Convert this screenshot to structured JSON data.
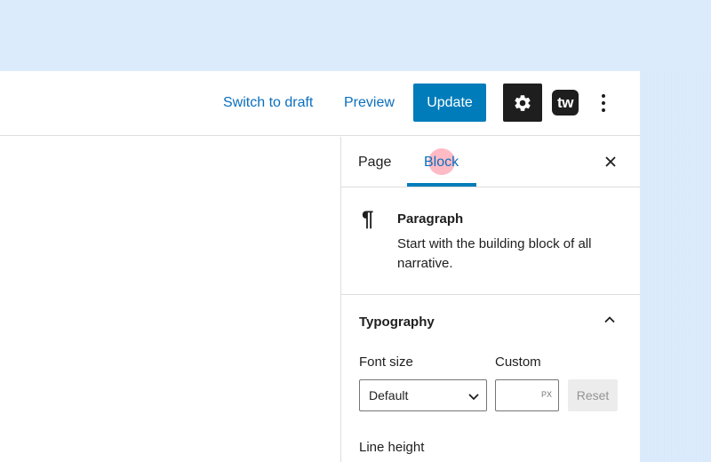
{
  "toolbar": {
    "switch_to_draft": "Switch to draft",
    "preview": "Preview",
    "update": "Update",
    "tw_logo": "tw",
    "settings_icon": "gear-icon",
    "more_icon": "more-vertical-icon"
  },
  "sidebar": {
    "tabs": [
      {
        "label": "Page",
        "active": false
      },
      {
        "label": "Block",
        "active": true
      }
    ],
    "close_icon": "close-icon",
    "block": {
      "icon": "paragraph-icon",
      "title": "Paragraph",
      "description": "Start with the building block of all narrative."
    },
    "typography": {
      "title": "Typography",
      "font_size_label": "Font size",
      "custom_label": "Custom",
      "font_size_value": "Default",
      "custom_unit": "PX",
      "custom_value": "",
      "reset": "Reset",
      "line_height_label": "Line height"
    }
  },
  "colors": {
    "accent": "#007cba",
    "link": "#0a6fbd",
    "background": "#dcebfc"
  }
}
